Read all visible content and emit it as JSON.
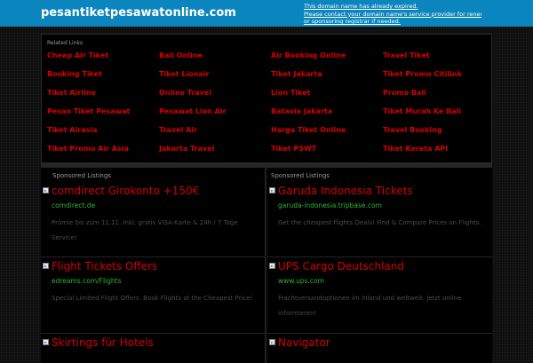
{
  "header": {
    "domain": "pesantiketpesawatonline.com",
    "notice_lines": [
      "This domain name has already expired.",
      "Please contact your domain name's service provider for renewal directly,",
      "or sponsoring registrar if needed."
    ]
  },
  "related": {
    "heading": "Related Links",
    "links": [
      "Cheap Air Tiket",
      "Bali Online",
      "Air Booking Online",
      "Travel Tiket",
      "Booking Tiket",
      "Tiket Lionair",
      "Tiket Jakarta",
      "Tiket Promo Citilink",
      "Tiket Airline",
      "Online Travel",
      "Lion Tiket",
      "Promo Bali",
      "Pesan Tiket Pesawat",
      "Pesawat Lion Air",
      "Batavia Jakarta",
      "Tiket Murah Ke Bali",
      "Tiket Airasia",
      "Travel Air",
      "Harga Tiket Online",
      "Travel Booking",
      "Tiket Promo Air Asia",
      "Jakarta Travel",
      "Tiket PSWT",
      "Tiket Kereta API"
    ]
  },
  "sponsored_left": {
    "heading": "Sponsored Listings",
    "listings": [
      {
        "title": "comdirect Girokonto +150€",
        "url": "comdirect.de",
        "desc": "Prämie bis zum 11.11. Inkl. gratis VISA-Karte & 24h / 7 Tage Service!"
      },
      {
        "title": "Flight Tickets Offers",
        "url": "edreams.com/Flights",
        "desc": "Special Limited Flight Offers. Book Flights at the Cheapest Price!"
      },
      {
        "title": "Skirtings für Hotels",
        "url": "",
        "desc": ""
      }
    ]
  },
  "sponsored_right": {
    "heading": "Sponsored Listings",
    "listings": [
      {
        "title": "Garuda Indonesia Tickets",
        "url": "garuda-indonesia.tripbase.com",
        "desc": "Get the cheapest flights Deals! Find & Compare Prices on Flights."
      },
      {
        "title": "UPS Cargo Deutschland",
        "url": "www.ups.com",
        "desc": "Frachtversandoptionen im Inland und weltweit. Jetzt online informieren!"
      },
      {
        "title": "Navigator",
        "url": "",
        "desc": ""
      }
    ]
  }
}
